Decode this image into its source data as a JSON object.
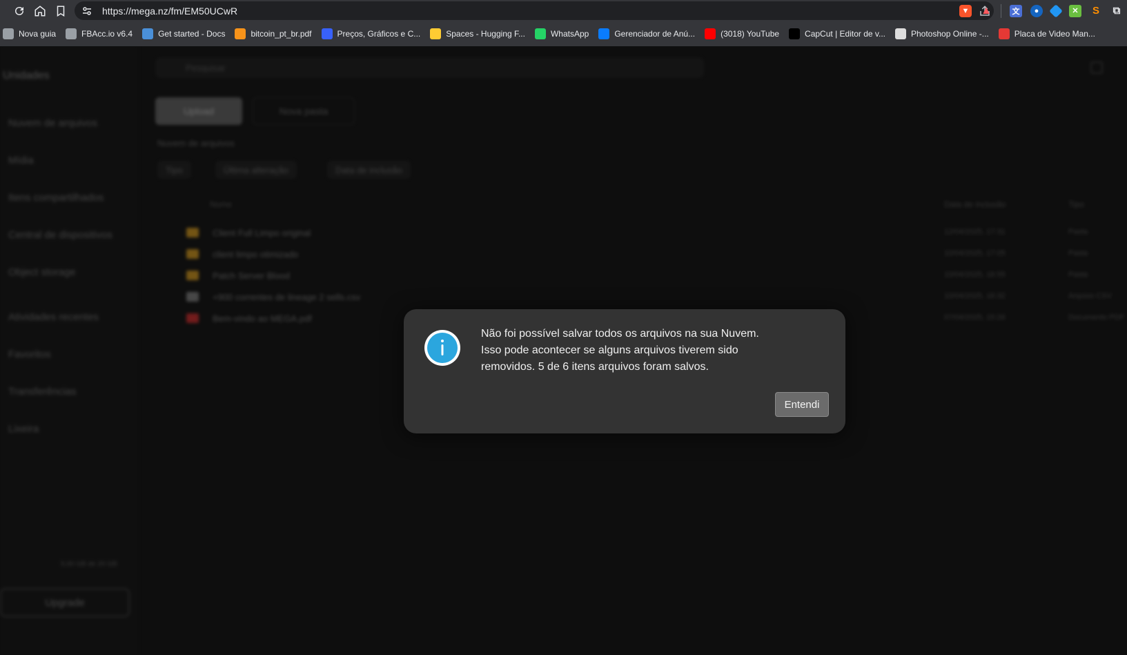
{
  "browser": {
    "url": "https://mega.nz/fm/EM50UCwR",
    "bookmarks": [
      {
        "label": "Nova guia",
        "icon": "globe-icon",
        "color": "#9aa0a6"
      },
      {
        "label": "FBAcc.io v6.4",
        "icon": "globe-icon",
        "color": "#9aa0a6"
      },
      {
        "label": "Get started - Docs",
        "icon": "docs-icon",
        "color": "#4a90d9"
      },
      {
        "label": "bitcoin_pt_br.pdf",
        "icon": "bitcoin-icon",
        "color": "#f7931a"
      },
      {
        "label": "Preços, Gráficos e C...",
        "icon": "coinmarketcap-icon",
        "color": "#3861fb"
      },
      {
        "label": "Spaces - Hugging F...",
        "icon": "huggingface-icon",
        "color": "#ffcc33"
      },
      {
        "label": "WhatsApp",
        "icon": "whatsapp-icon",
        "color": "#25d366"
      },
      {
        "label": "Gerenciador de Anú...",
        "icon": "meta-icon",
        "color": "#0a7cff"
      },
      {
        "label": "(3018) YouTube",
        "icon": "youtube-icon",
        "color": "#ff0000"
      },
      {
        "label": "CapCut | Editor de v...",
        "icon": "capcut-icon",
        "color": "#000000"
      },
      {
        "label": "Photoshop Online -...",
        "icon": "photoshop-icon",
        "color": "#dddddd"
      },
      {
        "label": "Placa de Video Man...",
        "icon": "placa-icon",
        "color": "#e53935"
      }
    ]
  },
  "sidebar": {
    "title": "Unidades",
    "items": [
      "Nuvem de arquivos",
      "Mídia",
      "Itens compartilhados",
      "Central de dispositivos",
      "Object storage",
      "Atividades recentes",
      "Favoritos",
      "Transferências",
      "Lixeira"
    ],
    "usage": "5,00 GB de 20 GB",
    "upgrade": "Upgrade"
  },
  "main": {
    "search_placeholder": "Pesquisar",
    "upload_label": "Upload",
    "new_folder_label": "Nova pasta",
    "section_title": "Nuvem de arquivos",
    "filters": [
      "Tipo",
      "Última alteração",
      "Data de inclusão"
    ],
    "headers": {
      "name": "Nome",
      "date": "Data de inclusão",
      "type": "Tipo"
    },
    "rows": [
      {
        "name": "Client Full Limpo original",
        "date": "12/04/2025, 17:31",
        "type": "Pasta"
      },
      {
        "name": "client limpo otimizado",
        "date": "10/04/2025, 17:05",
        "type": "Pasta"
      },
      {
        "name": "Patch Server Blood",
        "date": "10/04/2025, 16:55",
        "type": "Pasta"
      },
      {
        "name": "+900 correntes de lineage 2 sells.csv",
        "date": "10/04/2025, 16:32",
        "type": "Arquivo CSV"
      },
      {
        "name": "Bem-vindo ao MEGA.pdf",
        "date": "07/04/2025, 15:26",
        "type": "Documento PDF"
      }
    ]
  },
  "dialog": {
    "message_line1": "Não foi possível salvar todos os arquivos na sua Nuvem.",
    "message_line2": "Isso pode acontecer se alguns arquivos tiverem sido",
    "message_line3": "removidos. 5 de 6 itens arquivos foram salvos.",
    "button": "Entendi",
    "icon": "info-icon",
    "icon_color": "#2ba6de"
  }
}
